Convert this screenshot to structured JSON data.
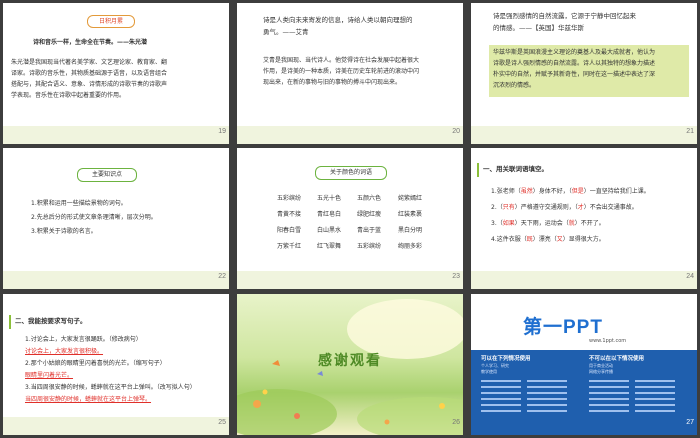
{
  "slides": [
    {
      "number": "19",
      "badge": "日积月累",
      "quote": "诗和音乐一样，生命全在节奏。——朱光潜",
      "para": [
        "朱光潜是我国现当代著名美学家、文艺理论家、教育家、翻",
        "译家。诗歌的音乐性，其物质基础源于语音，以及语音组合",
        "搭配与，其配合语义、意象、诗情形成的诗歌节奏的诗歌声",
        "学表现。音乐性在诗歌中起着重要的作用。"
      ]
    },
    {
      "number": "20",
      "quote": [
        "诗是人类向未来寄发的信息，诗给人类以朝向理想的",
        "勇气。——艾青"
      ],
      "para": [
        "艾青是我国现、当代诗人。他觉得诗在社会发展中起着很大",
        "作用，是诗美的一种本质，诗美在历史车轮前进的滚动中闪",
        "现出来，在新的事物与旧的事物的搏斗中闪现出来。"
      ]
    },
    {
      "number": "21",
      "quote": [
        "诗是强烈感情的自然流露，它源于宁静中回忆起来",
        "的情感。——【英国】华兹华斯"
      ],
      "para": [
        "华兹华斯是英国浪漫主义理论的奠基人及最大成就者，他认为",
        "诗歌是诗人强烈情感的自然流露。诗人以其独特的想象力描述",
        "朴实中的自然，并赋予其新奇性，同时在这一描述中表达了深",
        "沉浓烈的情感。"
      ]
    },
    {
      "number": "22",
      "badge": "主要知识点",
      "items": [
        "1.积累和运用一些描绘景物的词句。",
        "2.先总后分的形式使文章条理清晰，层次分明。",
        "3.积累关于诗歌的名言。"
      ]
    },
    {
      "number": "23",
      "badge": "关于颜色的词语",
      "idioms": [
        [
          "五彩缤纷",
          "五光十色",
          "五颜六色",
          "姹紫嫣红"
        ],
        [
          "青黄不接",
          "青红皂白",
          "绿肥红瘦",
          "红装素裹"
        ],
        [
          "阳春白雪",
          "白山黑水",
          "青出于蓝",
          "黑白分明"
        ],
        [
          "万紫千红",
          "红飞翠舞",
          "五彩缤纷",
          "绚丽多彩"
        ]
      ]
    },
    {
      "number": "24",
      "heading": "一、用关联词语填空。",
      "rows": [
        {
          "pre": "1.张老师（",
          "a": "虽然",
          "mid": "）身体不好，（",
          "b": "但是",
          "post": "）一直坚持给我们上课。"
        },
        {
          "pre": "2.（",
          "a": "只有",
          "mid": "）严格遵守交通规则，（",
          "b": "才",
          "post": "）不会出交通事故。"
        },
        {
          "pre": "3.（",
          "a": "如果",
          "mid": "）天下雨，运动会（",
          "b": "就",
          "post": "）不开了。"
        },
        {
          "pre": "4.这件衣服（",
          "a": "既",
          "mid": "）漂亮（",
          "b": "又",
          "post": "）显得很大方。"
        }
      ]
    },
    {
      "number": "25",
      "heading": "二、我能按要求写句子。",
      "lines": [
        {
          "text": "1.讨论会上，大家发言很踊跃。（修改病句）",
          "red": false
        },
        {
          "text": "讨论会上，大家发言很积极。",
          "red": true
        },
        {
          "text": "2.那个小姑娘的眼睛里闪着喜悦的光芒。（缩写句子）",
          "red": false
        },
        {
          "text": "眼睛里闪着光芒。",
          "red": true
        },
        {
          "text": "3.当四周很安静的时候，蟋蟀就在这平台上弹叫。（改写拟人句）",
          "red": false
        },
        {
          "text": "当四周很安静的时候，蟋蟀就在这平台上弹琴。",
          "red": true
        }
      ]
    },
    {
      "number": "26",
      "title": "感谢观看"
    },
    {
      "number": "27",
      "logo": "第一PPT",
      "url": "www.1ppt.com",
      "left_head": "可以在下列情况使用",
      "right_head": "不可以在以下情况使用",
      "left_items": [
        "个人学习、研究",
        "教学使用"
      ],
      "right_items": [
        "用于商业活动",
        "网络分享传播"
      ]
    }
  ],
  "colors": {
    "accent_green": "#8bbf3a",
    "accent_orange": "#e39a3a",
    "link_blue": "#1c6cc4",
    "answer_red": "#e0302a"
  }
}
